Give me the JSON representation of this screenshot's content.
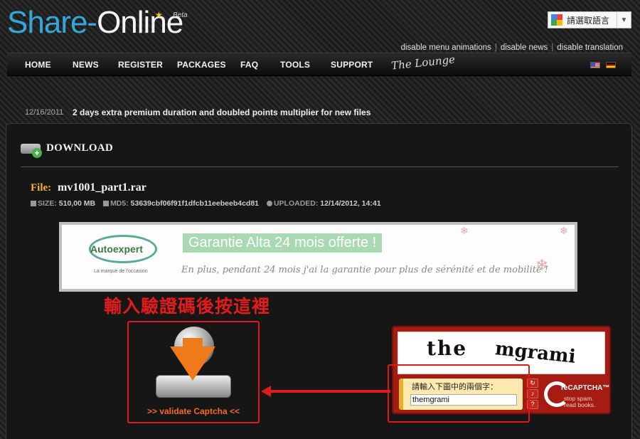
{
  "logo": {
    "part1": "Share-",
    "part2": "Online",
    "badge": "Beta"
  },
  "translate": {
    "label": "請選取語言"
  },
  "top_links": [
    "disable menu animations",
    "disable news",
    "disable translation"
  ],
  "nav": {
    "items": [
      "HOME",
      "NEWS",
      "REGISTER",
      "PACKAGES",
      "FAQ",
      "TOOLS",
      "SUPPORT"
    ],
    "lounge": "The Lounge",
    "flags": [
      "us-flag",
      "de-flag"
    ]
  },
  "news": {
    "date": "12/16/2011",
    "text": "2 days extra premium duration and doubled points multiplier for new files"
  },
  "download": {
    "title": "DOWNLOAD",
    "file_label": "File:",
    "file_name": "mv1001_part1.rar",
    "size_label": "SIZE:",
    "size_value": "510,00 MB",
    "md5_label": "MD5:",
    "md5_value": "53639cbf06f91f1dfcb11eebeeb4cd81",
    "uploaded_label": "UPLOADED:",
    "uploaded_value": "12/14/2012, 14:41"
  },
  "ad": {
    "logo": "Autoexpert",
    "tagline": "La marque de l'occasion",
    "headline": "Garantie Alta 24 mois offerte !",
    "sub": "En plus, pendant 24 mois j'ai la garantie pour plus de sérénité et de mobilité !"
  },
  "annotation": {
    "caption": "輸入驗證碼後按這裡"
  },
  "validate": {
    "label": ">> validate Captcha <<"
  },
  "recaptcha": {
    "word1": "the",
    "word2": "mgrami",
    "prompt": "請輸入下圖中的兩個字：",
    "input_value": "themgrami",
    "brand": "reCAPTCHA™",
    "tag_line1": "stop spam.",
    "tag_line2": "read books.",
    "buttons": [
      "↻",
      "♪",
      "?"
    ]
  },
  "colors": {
    "logo_blue": "#34a7d6",
    "annotation_red": "#e01a1a",
    "validate_orange": "#f36b25",
    "file_label_gold": "#f3b13a",
    "recaptcha_red": "#a61b12"
  }
}
